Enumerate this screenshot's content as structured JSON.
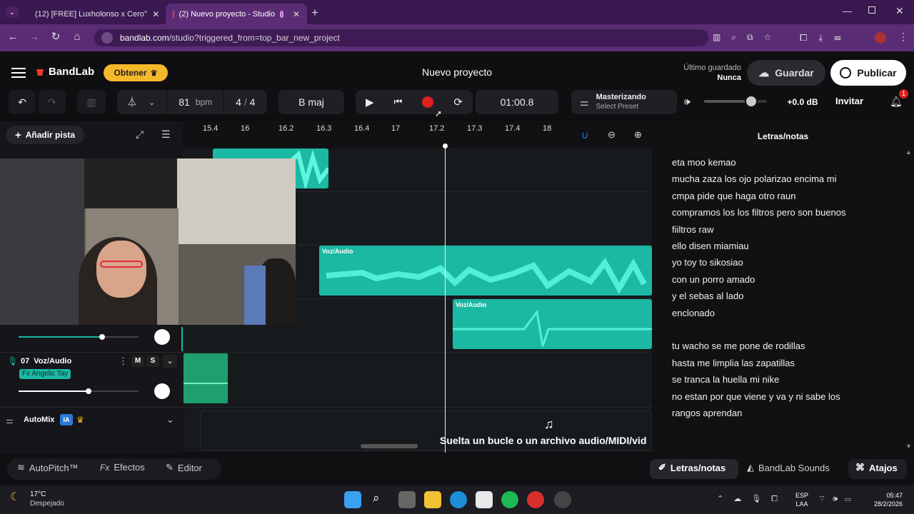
{
  "browser": {
    "tabs": [
      {
        "label": "(12) [FREE] Luxholonso x Cero°"
      },
      {
        "label": "(2) Nuevo proyecto - Studio"
      }
    ],
    "url_domain": "bandlab.com",
    "url_path": "/studio?triggered_from=top_bar_new_project"
  },
  "header": {
    "brand": "BandLab",
    "obtener_label": "Obtener",
    "project_title": "Nuevo proyecto",
    "last_saved_label": "Último guardado",
    "last_saved_value": "Nunca",
    "save_label": "Guardar",
    "publish_label": "Publicar"
  },
  "transport": {
    "bpm": "81",
    "bpm_unit": "bpm",
    "time_sig_num": "4",
    "time_sig_den": "4",
    "key": "B maj",
    "time": "01:00.8",
    "mastering_title": "Masterizando",
    "mastering_sub": "Select Preset",
    "volume_db": "+0.0 dB",
    "volume_level": 0.75,
    "invite_label": "Invitar",
    "notif_count": "1"
  },
  "toolbar": {
    "add_track_label": "Añadir pista"
  },
  "ruler": [
    "15.4",
    "16",
    "16.2",
    "16.3",
    "16.4",
    "17",
    "17.2",
    "17.3",
    "17.4",
    "18"
  ],
  "tracks": {
    "track7_num": "07",
    "track7_name": "Voz/Audio",
    "track7_fx": "Fx Angelic Tay",
    "mute": "M",
    "solo": "S",
    "automix_label": "AutoMix",
    "ai_badge": "IA",
    "clip_label_1": "Voz/Audio",
    "clip_label_2": "Voz/Audio",
    "drop_hint": "Suelta un bucle o un archivo audio/MIDI/vid"
  },
  "lyrics": {
    "title": "Letras/notas",
    "lines": [
      "eta moo kemao",
      " mucha zaza los ojo polarizao encima mi",
      "cmpa pide que haga otro raun",
      "compramos los los filtros pero son buenos",
      "fiiltros raw",
      "ello disen miamiau",
      "yo toy to sikosiao",
      "con un porro amado",
      "y el sebas al lado",
      "enclonado",
      "",
      "tu wacho se me pone de rodillas",
      "hasta me limplia las zapatillas",
      "se tranca la huella mi nike",
      "no estan por que viene y va y ni sabe los",
      "rangos  aprendan"
    ]
  },
  "bottom": {
    "autopitch": "AutoPitch™",
    "effects": "Efectos",
    "editor": "Editor",
    "lyrics_tab": "Letras/notas",
    "sounds_tab": "BandLab Sounds",
    "shortcuts": "Atajos"
  },
  "taskbar": {
    "temp": "17°C",
    "weather": "Despejado",
    "lang1": "ESP",
    "lang2": "LAA",
    "time": "05:47",
    "date": "28/2/2026"
  },
  "colors": {
    "accent_teal": "#1bb8a3",
    "record_red": "#e0201f",
    "brand_red": "#f03b2f",
    "chrome_purple": "#5a2c74",
    "gold": "#f4b82a"
  }
}
